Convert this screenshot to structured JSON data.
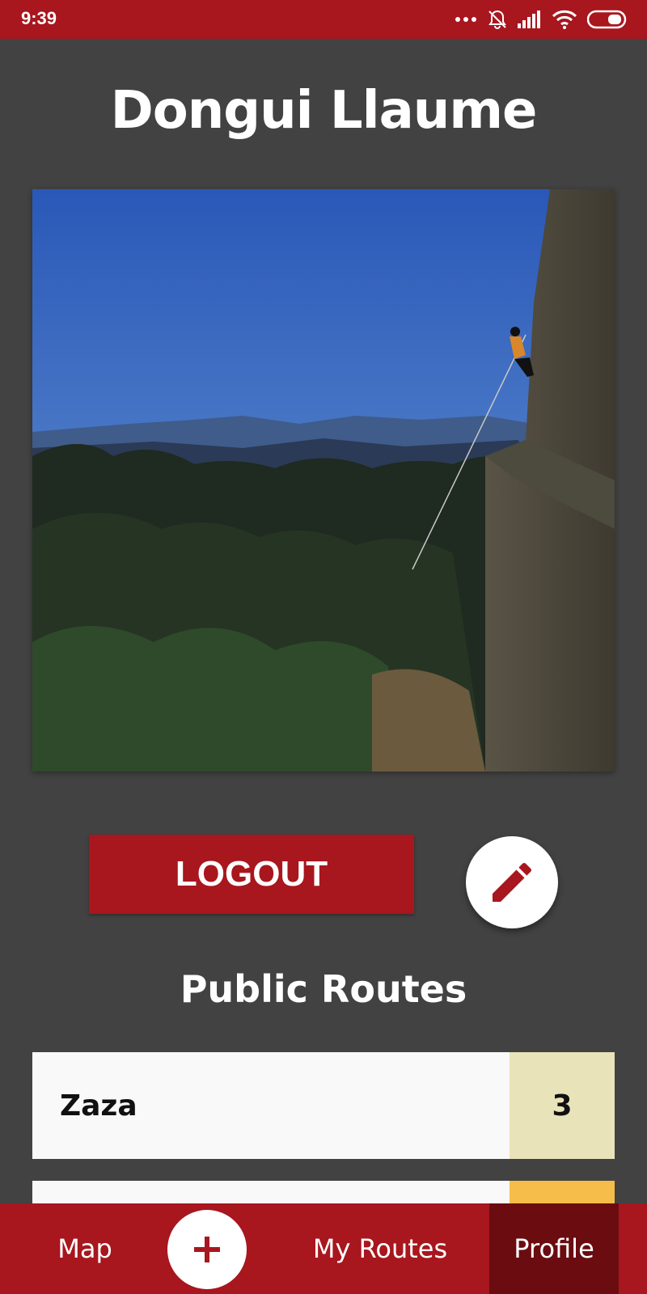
{
  "status_bar": {
    "time": "9:39"
  },
  "profile": {
    "name": "Dongui Llaume"
  },
  "actions": {
    "logout_label": "LOGOUT"
  },
  "section": {
    "title": "Public Routes"
  },
  "routes": [
    {
      "name": "Zaza",
      "count": "3",
      "count_color": "#e9e3ba"
    },
    {
      "name": "",
      "count": "",
      "count_color": "#f7bd4a"
    }
  ],
  "bottom_nav": {
    "map": "Map",
    "my_routes": "My Routes",
    "profile": "Profile"
  },
  "colors": {
    "brand": "#a8161e",
    "brand_dark": "#6a0c10",
    "background": "#424242"
  },
  "icons": {
    "edit": "pencil-icon",
    "add": "plus-icon"
  }
}
